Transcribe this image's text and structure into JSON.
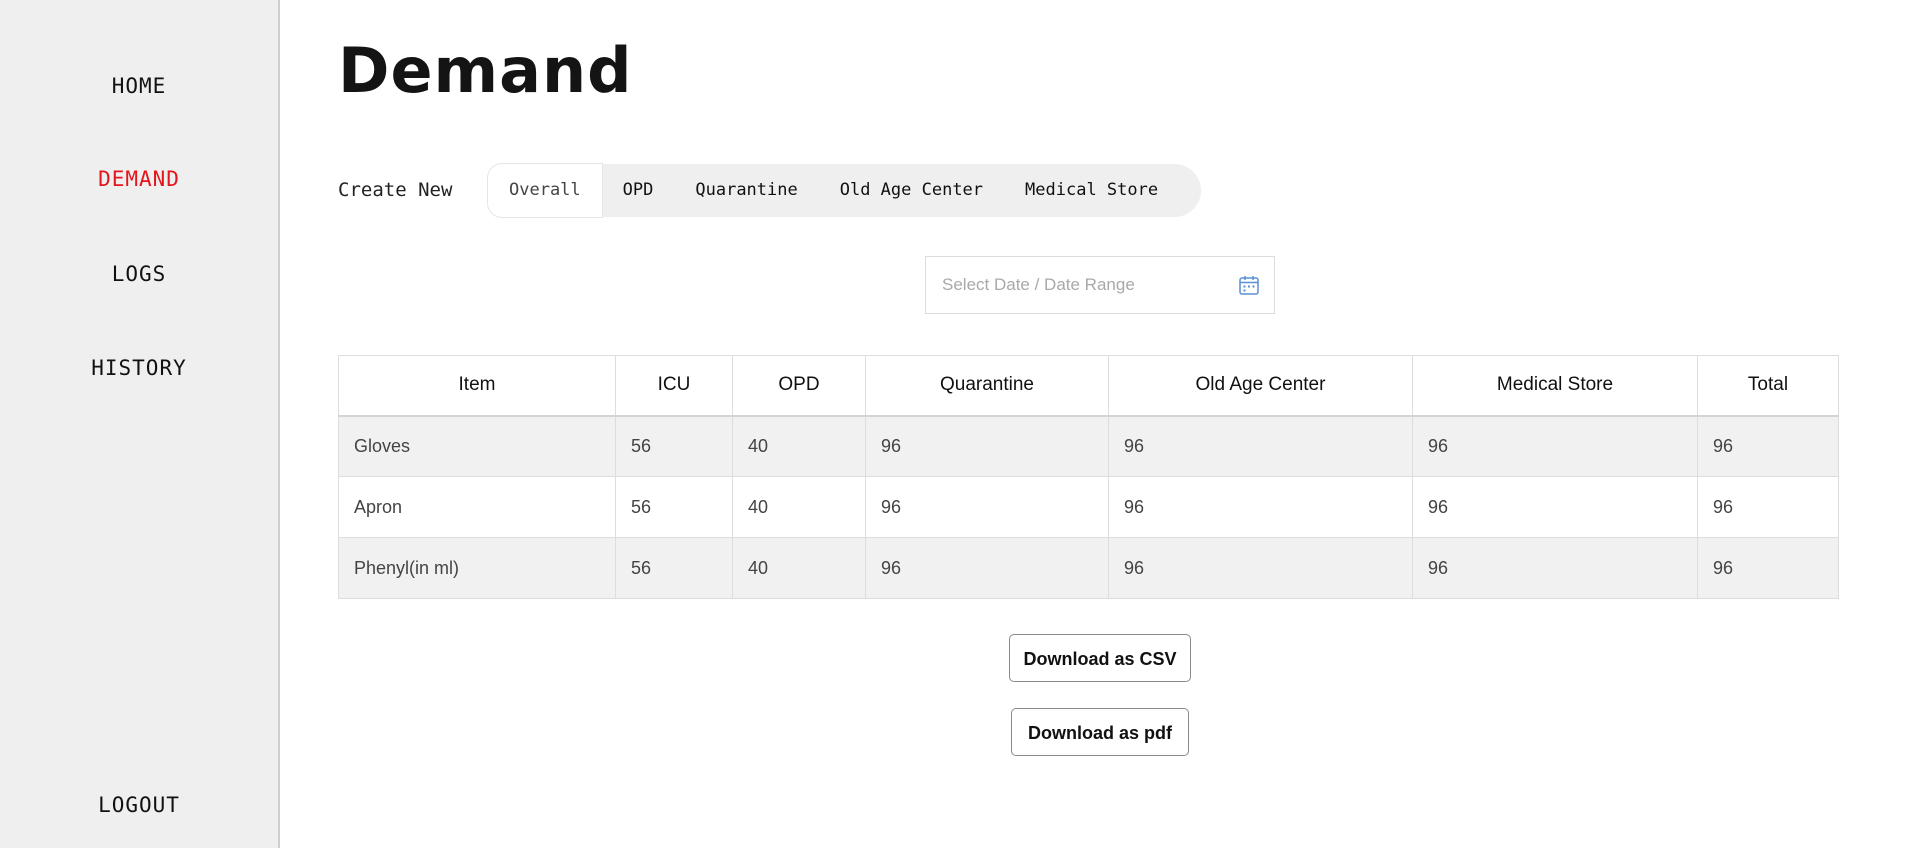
{
  "sidebar": {
    "items": [
      {
        "label": "HOME"
      },
      {
        "label": "DEMAND"
      },
      {
        "label": "LOGS"
      },
      {
        "label": "HISTORY"
      }
    ],
    "logout": "LOGOUT",
    "active_color": "#e3161b"
  },
  "page": {
    "title": "Demand"
  },
  "create_new": {
    "label": "Create New",
    "tabs": [
      {
        "label": "Overall",
        "active": true
      },
      {
        "label": "OPD"
      },
      {
        "label": "Quarantine"
      },
      {
        "label": "Old Age Center"
      },
      {
        "label": "Medical Store"
      }
    ]
  },
  "date_filter": {
    "placeholder": "Select Date / Date Range",
    "icon": "calendar-icon"
  },
  "table": {
    "headers": [
      "Item",
      "ICU",
      "OPD",
      "Quarantine",
      "Old Age Center",
      "Medical Store",
      "Total"
    ],
    "rows": [
      [
        "Gloves",
        "56",
        "40",
        "96",
        "96",
        "96",
        "96"
      ],
      [
        "Apron",
        "56",
        "40",
        "96",
        "96",
        "96",
        "96"
      ],
      [
        "Phenyl(in ml)",
        "56",
        "40",
        "96",
        "96",
        "96",
        "96"
      ]
    ]
  },
  "actions": {
    "csv": "Download as CSV",
    "pdf": "Download as pdf"
  }
}
